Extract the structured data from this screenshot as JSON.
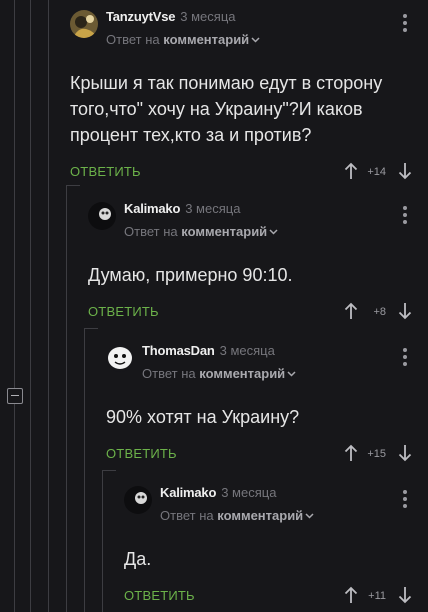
{
  "comments": [
    {
      "author": "TanzuytVse",
      "time": "3 месяца",
      "reply_prefix": "Ответ на",
      "reply_target": "комментарий",
      "text": "Крыши я так понимаю едут в сторону того,что\" хочу на Украину\"?И каков процент тех,кто за и против?",
      "reply_label": "ОТВЕТИТЬ",
      "score": "+14"
    },
    {
      "author": "Kalimako",
      "time": "3 месяца",
      "reply_prefix": "Ответ на",
      "reply_target": "комментарий",
      "text": "Думаю, примерно 90:10.",
      "reply_label": "ОТВЕТИТЬ",
      "score": "+8"
    },
    {
      "author": "ThomasDan",
      "time": "3 месяца",
      "reply_prefix": "Ответ на",
      "reply_target": "комментарий",
      "text": "90% хотят на Украину?",
      "reply_label": "ОТВЕТИТЬ",
      "score": "+15"
    },
    {
      "author": "Kalimako",
      "time": "3 месяца",
      "reply_prefix": "Ответ на",
      "reply_target": "комментарий",
      "text": "Да.",
      "reply_label": "ОТВЕТИТЬ",
      "score": "+11"
    }
  ],
  "colors": {
    "background": "#17171a",
    "reply_link": "#6cb24a",
    "thread_line": "#3d3d42",
    "muted_text": "#76767c"
  },
  "icons": [
    "avatar",
    "kebab-menu-icon",
    "chevron-down-icon",
    "arrow-up-icon",
    "arrow-down-icon",
    "collapse-thread-icon"
  ]
}
